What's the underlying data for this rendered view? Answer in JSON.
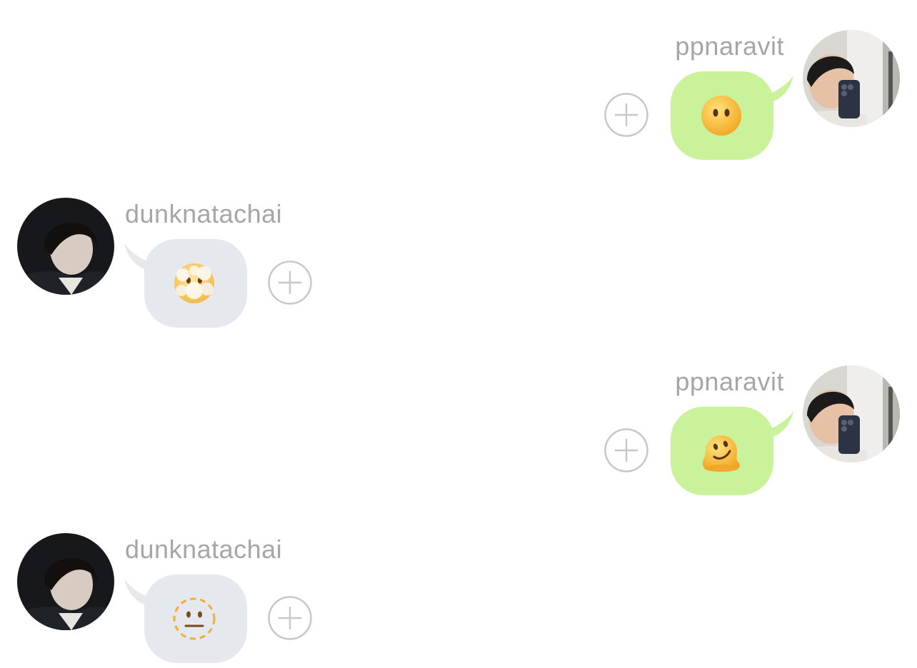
{
  "colors": {
    "outgoing_bubble": "#c9f29a",
    "incoming_bubble": "#e5e8ec",
    "sender_text": "#a6a6a6",
    "add_button_stroke": "#c8c8c8"
  },
  "messages": [
    {
      "direction": "outgoing",
      "sender": "ppnaravit",
      "emoji": "face-without-mouth-icon"
    },
    {
      "direction": "incoming",
      "sender": "dunknatachai",
      "emoji": "face-in-clouds-icon"
    },
    {
      "direction": "outgoing",
      "sender": "ppnaravit",
      "emoji": "melting-face-icon"
    },
    {
      "direction": "incoming",
      "sender": "dunknatachai",
      "emoji": "dotted-line-face-icon"
    }
  ]
}
